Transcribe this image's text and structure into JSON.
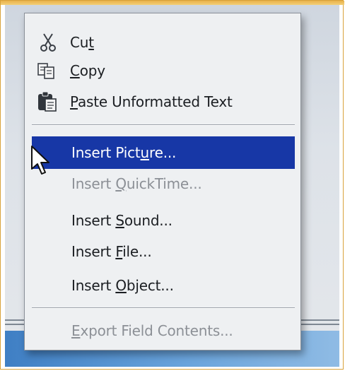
{
  "context_menu": {
    "items": [
      {
        "pre": "Cu",
        "mnemonic": "t",
        "post": "",
        "icon": "scissors-icon",
        "enabled": true
      },
      {
        "pre": "",
        "mnemonic": "C",
        "post": "opy",
        "icon": "copy-icon",
        "enabled": true
      },
      {
        "pre": "",
        "mnemonic": "P",
        "post": "aste Unformatted Text",
        "icon": "clipboard-icon",
        "enabled": true
      },
      {
        "pre": "Insert Pict",
        "mnemonic": "u",
        "post": "re...",
        "enabled": true,
        "selected": true
      },
      {
        "pre": "Insert ",
        "mnemonic": "Q",
        "post": "uickTime...",
        "enabled": false
      },
      {
        "pre": "Insert ",
        "mnemonic": "S",
        "post": "ound...",
        "enabled": true
      },
      {
        "pre": "Insert ",
        "mnemonic": "F",
        "post": "ile...",
        "enabled": true
      },
      {
        "pre": "Insert ",
        "mnemonic": "O",
        "post": "bject...",
        "enabled": true
      },
      {
        "pre": "",
        "mnemonic": "E",
        "post": "xport Field Contents...",
        "enabled": false
      }
    ]
  },
  "colors": {
    "selection": "#1737a6",
    "menu_background": "#eef0f2",
    "disabled_text": "#8c9096"
  },
  "cursor": {
    "icon": "arrow-cursor-icon"
  }
}
